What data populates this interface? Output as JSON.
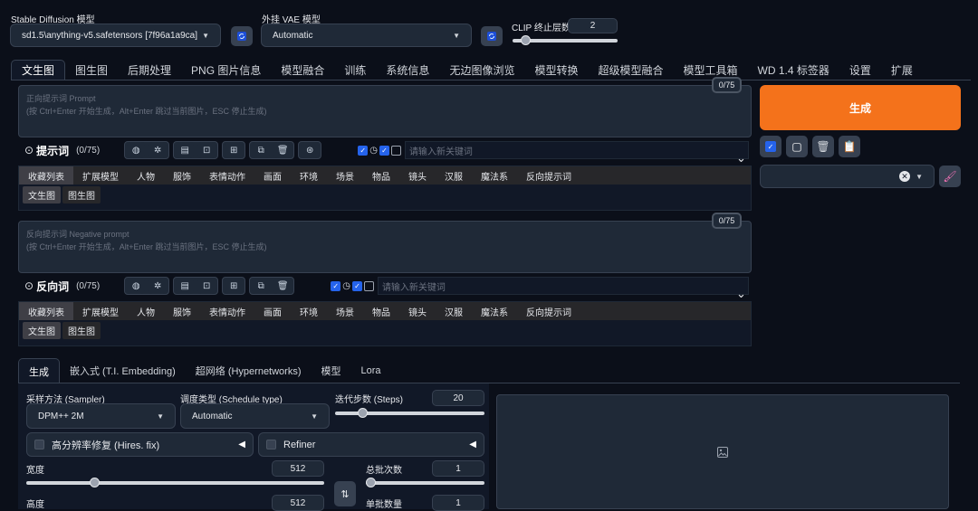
{
  "top": {
    "model_label": "Stable Diffusion 模型",
    "model_value": "sd1.5\\anything-v5.safetensors [7f96a1a9ca]",
    "vae_label": "外挂 VAE 模型",
    "vae_value": "Automatic",
    "clip_label": "CLIP 终止层数",
    "clip_value": "2",
    "clip_fraction": 0.083
  },
  "tabs": [
    "文生图",
    "图生图",
    "后期处理",
    "PNG 图片信息",
    "模型融合",
    "训练",
    "系统信息",
    "无边图像浏览",
    "模型转换",
    "超级模型融合",
    "模型工具箱",
    "WD 1.4 标签器",
    "设置",
    "扩展"
  ],
  "prompt": {
    "placeholder_line1": "正向提示词 Prompt",
    "placeholder_line2": "(按 Ctrl+Enter 开始生成，Alt+Enter 跳过当前图片，ESC 停止生成)",
    "counter": "0/75",
    "header_label": "提示词",
    "header_count": "(0/75)",
    "keyword_placeholder": "请输入新关键词"
  },
  "negative": {
    "placeholder_line1": "反向提示词 Negative prompt",
    "placeholder_line2": "(按 Ctrl+Enter 开始生成，Alt+Enter 跳过当前图片，ESC 停止生成)",
    "counter": "0/75",
    "header_label": "反向词",
    "header_count": "(0/75)",
    "keyword_placeholder": "请输入新关键词"
  },
  "category_tabs": [
    "收藏列表",
    "扩展模型",
    "人物",
    "服饰",
    "表情动作",
    "画面",
    "环境",
    "场景",
    "物品",
    "镜头",
    "汉服",
    "魔法系",
    "反向提示词"
  ],
  "sub_tabs": [
    "文生图",
    "图生图"
  ],
  "generate_label": "生成",
  "gen_tabs": [
    "生成",
    "嵌入式 (T.I. Embedding)",
    "超网络 (Hypernetworks)",
    "模型",
    "Lora"
  ],
  "sampler": {
    "label": "采样方法 (Sampler)",
    "value": "DPM++ 2M"
  },
  "schedule": {
    "label": "调度类型 (Schedule type)",
    "value": "Automatic"
  },
  "steps": {
    "label": "迭代步数 (Steps)",
    "value": "20",
    "fraction": 0.16
  },
  "hires": {
    "label": "高分辨率修复 (Hires. fix)"
  },
  "refiner": {
    "label": "Refiner"
  },
  "width": {
    "label": "宽度",
    "value": "512",
    "fraction": 0.22
  },
  "height": {
    "label": "高度",
    "value": "512"
  },
  "batch_count": {
    "label": "总批次数",
    "value": "1",
    "fraction": 0.0
  },
  "batch_size": {
    "label": "单批数量",
    "value": "1"
  },
  "colors": {
    "generate": "#f4721b",
    "accent": "#2563eb"
  }
}
